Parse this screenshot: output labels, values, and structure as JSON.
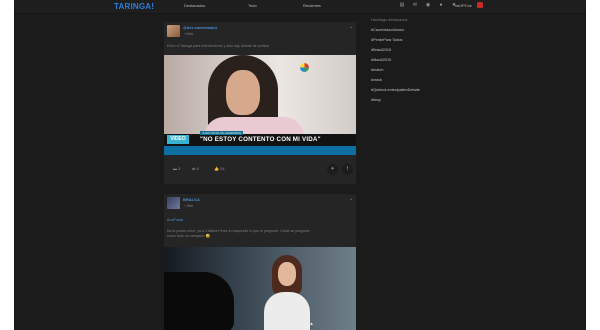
{
  "topbar": {
    "logo": "TARINGA!",
    "tabs": [
      "Destacados",
      "Todo",
      "Recientes"
    ],
    "icons": [
      "notepad-icon",
      "mail-icon",
      "eye-icon",
      "bell-icon",
      "star-icon"
    ],
    "username": "xelJPCxe"
  },
  "feed": {
    "posts": [
      {
        "author": "@der-comentador",
        "time": "24m",
        "text": "Entre el Taringa para entretenerme y solo hay debate de política",
        "video": {
          "lower_label": "JUAN NICOLÁS LEDERMAN",
          "headline": "\"NO ESTOY CONTENTO CON MI VIDA\"",
          "mark": "VIDEO"
        },
        "stats": {
          "comments": "3",
          "shares": "8",
          "likes": "24"
        }
      },
      {
        "author": "BRALCA",
        "time": "13m",
        "hashtag": "#LaPosta",
        "text_line1": "No lo puedo creer, ya a Cristina Pérez lo respondió lo que le pregunté. Cuidé su pregunta",
        "text_line2": "como todo un campeón 😀"
      }
    ]
  },
  "sidebar": {
    "title": "Hashtags destacados",
    "hashtags": [
      "#CacerolazoAlonso",
      "#PerdePara Todos",
      "#Brasil2015",
      "#Maciil2015",
      "#match",
      "#crack",
      "#QuienoLenteslpalienDebate",
      "#fiesy"
    ]
  },
  "colors": {
    "accent": "#2f7ed8",
    "background": "#1b1b1b",
    "card": "#252525"
  }
}
